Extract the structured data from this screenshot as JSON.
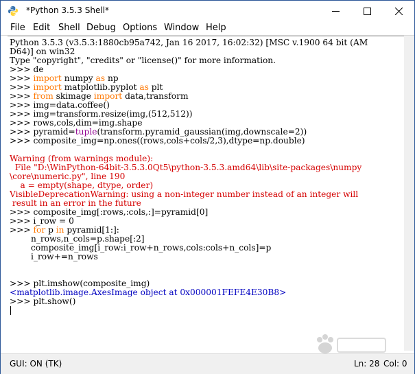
{
  "window": {
    "title": "*Python 3.5.3 Shell*"
  },
  "menu": {
    "file": "File",
    "edit": "Edit",
    "shell": "Shell",
    "debug": "Debug",
    "options": "Options",
    "window": "Window",
    "help": "Help"
  },
  "shell": {
    "l1": "Python 3.5.3 (v3.5.3:1880cb95a742, Jan 16 2017, 16:02:32) [MSC v.1900 64 bit (AM",
    "l2": "D64)] on win32",
    "l3": "Type \"copyright\", \"credits\" or \"license()\" for more information.",
    "p": ">>> ",
    "l4": "de",
    "kw_import": "import",
    "kw_from": "from",
    "kw_as": "as",
    "kw_for": "for",
    "kw_in": "in",
    "l5_mod": " numpy ",
    "l5_alias": " np",
    "l6_mod": " matplotlib.pyplot ",
    "l6_alias": " plt",
    "l7_mod": " skimage ",
    "l7_names": " data,transform",
    "l8": "img=data.coffee()",
    "l9": "img=transform.resize(img,(512,512))",
    "l10": "rows,cols,dim=img.shape",
    "l11a": "pyramid=",
    "l11_builtin": "tuple",
    "l11b": "(transform.pyramid_gaussian(img,downscale=2))",
    "l12": "composite_img=np.ones((rows,cols+cols/2,3),dtype=np.double)",
    "w1": "Warning (from warnings module):",
    "w2": "  File \"D:\\WinPython-64bit-3.5.3.0Qt5\\python-3.5.3.amd64\\lib\\site-packages\\numpy",
    "w3": "\\core\\numeric.py\", line 190",
    "w4": "    a = empty(shape, dtype, order)",
    "w5": "VisibleDeprecationWarning: using a non-integer number instead of an integer will",
    "w6": " result in an error in the future",
    "l13": "composite_img[:rows,:cols,:]=pyramid[0]",
    "l14": "i_row = 0",
    "l15a": " p ",
    "l15b": " pyramid[1:]:",
    "l16": "        n_rows,n_cols=p.shape[:2]",
    "l17": "        composite_img[i_row:i_row+n_rows,cols:cols+n_cols]=p",
    "l18": "        i_row+=n_rows",
    "l19": "plt.imshow(composite_img)",
    "l20": "<matplotlib.image.AxesImage object at 0x000001FEFE4E30B8>",
    "l21": "plt.show()"
  },
  "status": {
    "gui": "GUI: ON (TK)",
    "ln": "Ln: 28",
    "col": "Col: 0"
  }
}
